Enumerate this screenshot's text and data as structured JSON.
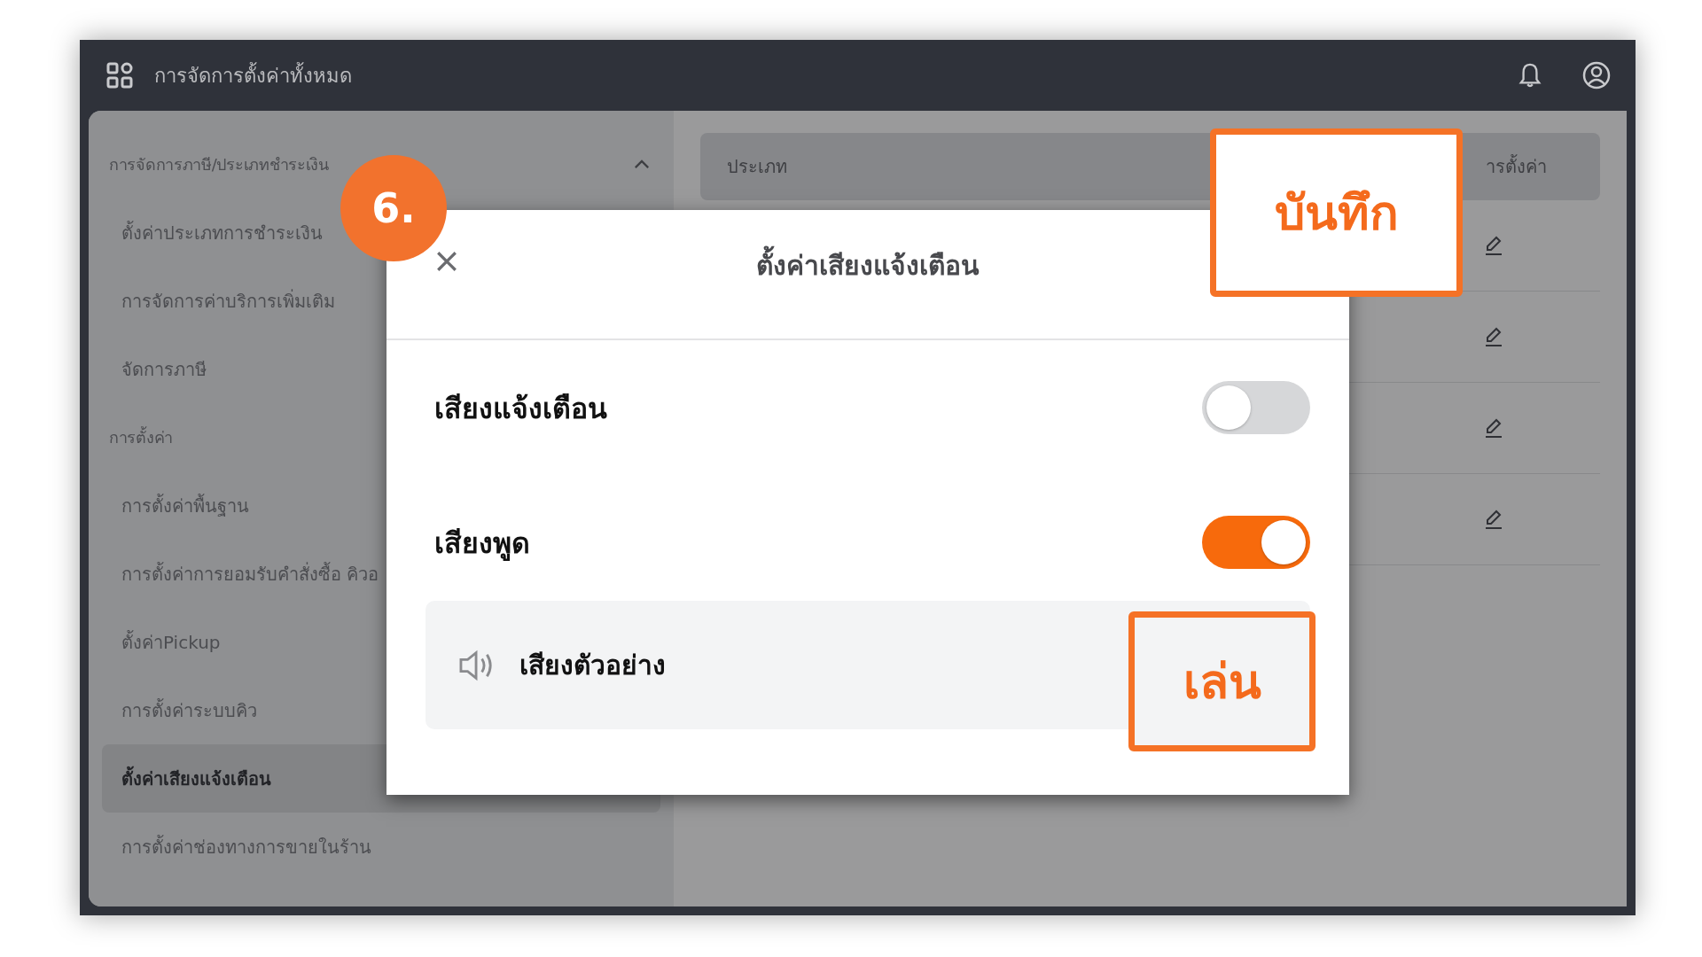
{
  "top_bar": {
    "title": "การจัดการตั้งค่าทั้งหมด"
  },
  "sidebar": {
    "groups": [
      {
        "label": "การจัดการภาษี/ประเภทชำระเงิน",
        "expanded": true,
        "children": [
          {
            "label": "ตั้งค่าประเภทการชำระเงิน",
            "selected": false
          },
          {
            "label": "การจัดการค่าบริการเพิ่มเติม",
            "selected": false
          },
          {
            "label": "จัดการภาษี",
            "selected": false
          }
        ]
      },
      {
        "label": "การตั้งค่า",
        "children": [
          {
            "label": "การตั้งค่าพื้นฐาน",
            "selected": false
          },
          {
            "label": "การตั้งค่าการยอมรับคำสั่งซื้อ คิวอ",
            "selected": false
          },
          {
            "label": "ตั้งค่าPickup",
            "selected": false
          },
          {
            "label": "การตั้งค่าระบบคิว",
            "selected": false
          },
          {
            "label": "ตั้งค่าเสียงแจ้งเตือน",
            "selected": true
          },
          {
            "label": "การตั้งค่าช่องทางการขายในร้าน",
            "selected": false
          }
        ]
      }
    ]
  },
  "table": {
    "columns": [
      "ประเภท",
      "ารตั้งค่า"
    ],
    "rows": [
      {
        "kind": "editable"
      },
      {
        "kind": "editable"
      },
      {
        "kind": "editable"
      },
      {
        "kind": "editable"
      }
    ]
  },
  "modal": {
    "title": "ตั้งค่าเสียงแจ้งเตือน",
    "settings": [
      {
        "label": "เสียงแจ้งเตือน",
        "on": false
      },
      {
        "label": "เสียงพูด",
        "on": true
      }
    ],
    "preview": {
      "label": "เสียงตัวอย่าง",
      "button": "เล่น"
    },
    "save_button": "บันทึก"
  },
  "step_badge": "6."
}
